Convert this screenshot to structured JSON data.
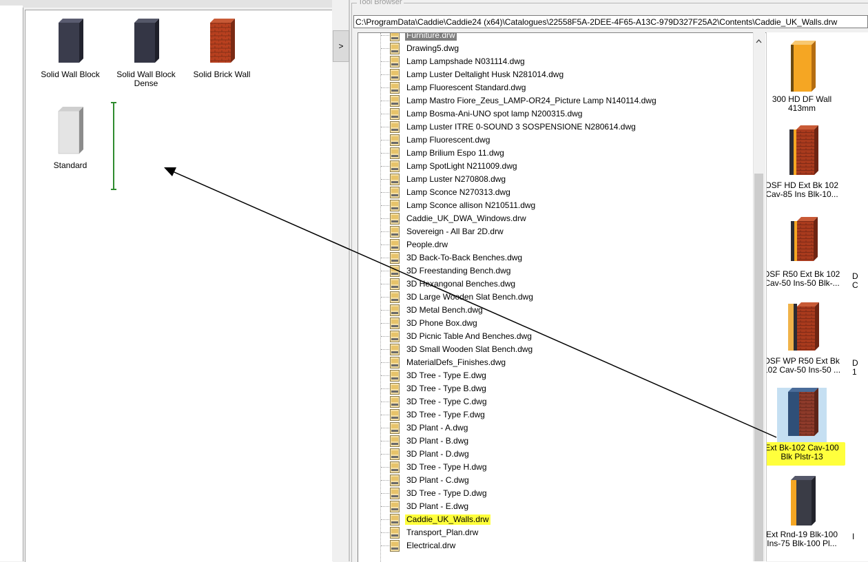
{
  "toolbar": {
    "group_title": "Tool Browser",
    "path": "C:\\ProgramData\\Caddie\\Caddie24 (x64)\\Catalogues\\22558F5A-2DEE-4F65-A13C-979D327F25A2\\Contents\\Caddie_UK_Walls.drw",
    "collapse_glyph": ">"
  },
  "palette": {
    "items": [
      {
        "label": "Solid Wall Block",
        "icon": "dark-block-icon"
      },
      {
        "label": "Solid Wall Block Dense",
        "icon": "dark-block-dense-icon"
      },
      {
        "label": "Solid Brick Wall",
        "icon": "brick-wall-icon"
      },
      {
        "label": "Standard",
        "icon": "grey-block-icon"
      }
    ]
  },
  "tree": {
    "items": [
      "Furniture.drw",
      "Drawing5.dwg",
      "Lamp Lampshade N031114.dwg",
      "Lamp Luster Deltalight Husk N281014.dwg",
      "Lamp Fluorescent Standard.dwg",
      "Lamp Mastro Fiore_Zeus_LAMP-OR24_Picture Lamp N140114.dwg",
      "Lamp Bosma-Ani-UNO spot lamp N200315.dwg",
      "Lamp Luster ITRE 0-SOUND 3 SOSPENSIONE N280614.dwg",
      "Lamp Fluorescent.dwg",
      "Lamp Brilium Espo 11.dwg",
      "Lamp SpotLight N211009.dwg",
      "Lamp Luster N270808.dwg",
      "Lamp Sconce N270313.dwg",
      "Lamp Sconce allison N210511.dwg",
      "Caddie_UK_DWA_Windows.drw",
      "Sovereign - All Bar 2D.drw",
      "People.drw",
      "3D Back-To-Back Benches.dwg",
      "3D Freestanding Bench.dwg",
      "3D Hexangonal Benches.dwg",
      "3D Large Wooden Slat Bench.dwg",
      "3D Metal Bench.dwg",
      "3D Phone Box.dwg",
      "3D Picnic Table And Benches.dwg",
      "3D Small Wooden Slat Bench.dwg",
      "MaterialDefs_Finishes.dwg",
      "3D Tree - Type E.dwg",
      "3D Tree - Type B.dwg",
      "3D Tree - Type C.dwg",
      "3D Tree - Type F.dwg",
      "3D Plant - A.dwg",
      "3D Plant - B.dwg",
      "3D Plant - D.dwg",
      "3D Tree - Type H.dwg",
      "3D Plant - C.dwg",
      "3D Tree - Type D.dwg",
      "3D Plant - E.dwg",
      "Caddie_UK_Walls.drw",
      "Transport_Plan.drw",
      "Electrical.drw"
    ],
    "selected_index": 0,
    "highlighted_index": 37
  },
  "thumbnails": {
    "items": [
      {
        "label": "300 HD DF Wall 413mm",
        "side_text": ""
      },
      {
        "label": "DSF HD Ext Bk 102 Cav-85 Ins Blk-10...",
        "side_text": ""
      },
      {
        "label": "DSF R50 Ext Bk 102 Cav-50 Ins-50 Blk-...",
        "side_text": "D C"
      },
      {
        "label": "DSF WP R50 Ext Bk 102 Cav-50 Ins-50 ...",
        "side_text": "D 1"
      },
      {
        "label": "Ext Bk-102 Cav-100 Blk Plstr-13",
        "side_text": ""
      },
      {
        "label": "Ext Rnd-19 Blk-100 Ins-75 Blk-100 Pl...",
        "side_text": "I"
      }
    ],
    "selected_index": 4
  },
  "colors": {
    "highlight": "#ffff3c",
    "selection": "#c5dff2",
    "cursor_green": "#2e8b2e"
  }
}
